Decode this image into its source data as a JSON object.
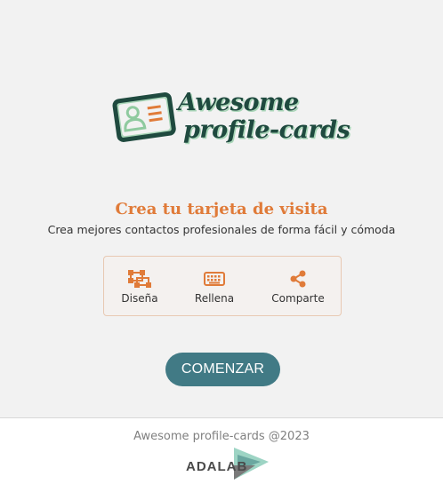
{
  "logo": {
    "line1": "Awesome",
    "line2": "profile-cards"
  },
  "hero": {
    "title": "Crea tu tarjeta de visita",
    "subtitle": "Crea mejores contactos profesionales de forma fácil y cómoda"
  },
  "features": [
    {
      "label": "Diseña",
      "icon": "object-group-icon"
    },
    {
      "label": "Rellena",
      "icon": "keyboard-icon"
    },
    {
      "label": "Comparte",
      "icon": "share-icon"
    }
  ],
  "cta": {
    "label": "COMENZAR"
  },
  "footer": {
    "copyright": "Awesome profile-cards @2023",
    "brand": "ADALAB"
  },
  "colors": {
    "accent": "#e07b39",
    "button": "#417a85",
    "logo_dark": "#1f4a3f",
    "logo_light": "#a9d6b8",
    "background": "#f2f2f2"
  }
}
